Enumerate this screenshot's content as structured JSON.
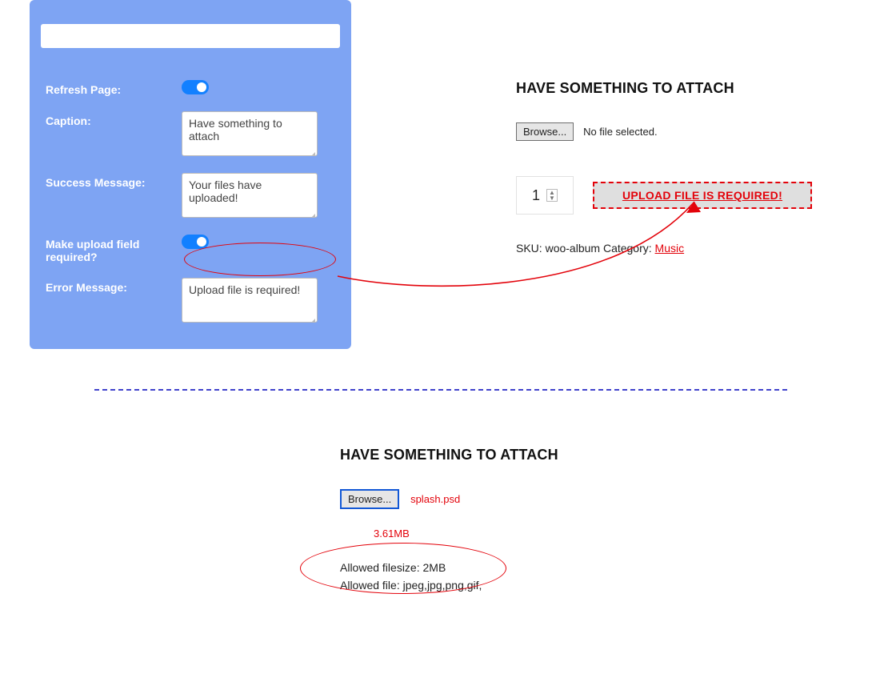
{
  "settings": {
    "refresh_label": "Refresh Page:",
    "caption_label": "Caption:",
    "caption_value": "Have something to attach",
    "success_label": "Success Message:",
    "success_value": "Your files have uploaded!",
    "required_label": "Make upload field required?",
    "error_label": "Error Message:",
    "error_value": "Upload file is required!"
  },
  "preview1": {
    "heading": "HAVE SOMETHING TO ATTACH",
    "browse_label": "Browse...",
    "file_status": "No file selected.",
    "qty_value": "1",
    "error_badge": "UPLOAD FILE IS REQUIRED!",
    "sku_prefix": "SKU: ",
    "sku_value": "woo-album",
    "category_prefix": " Category: ",
    "category_link": "Music"
  },
  "preview2": {
    "heading": "HAVE SOMETHING TO ATTACH",
    "browse_label": "Browse...",
    "selected_file": "splash.psd",
    "file_size": "3.61MB",
    "allowed_size": "Allowed filesize: 2MB",
    "allowed_types": "Allowed file: jpeg,jpg,png,gif,"
  }
}
